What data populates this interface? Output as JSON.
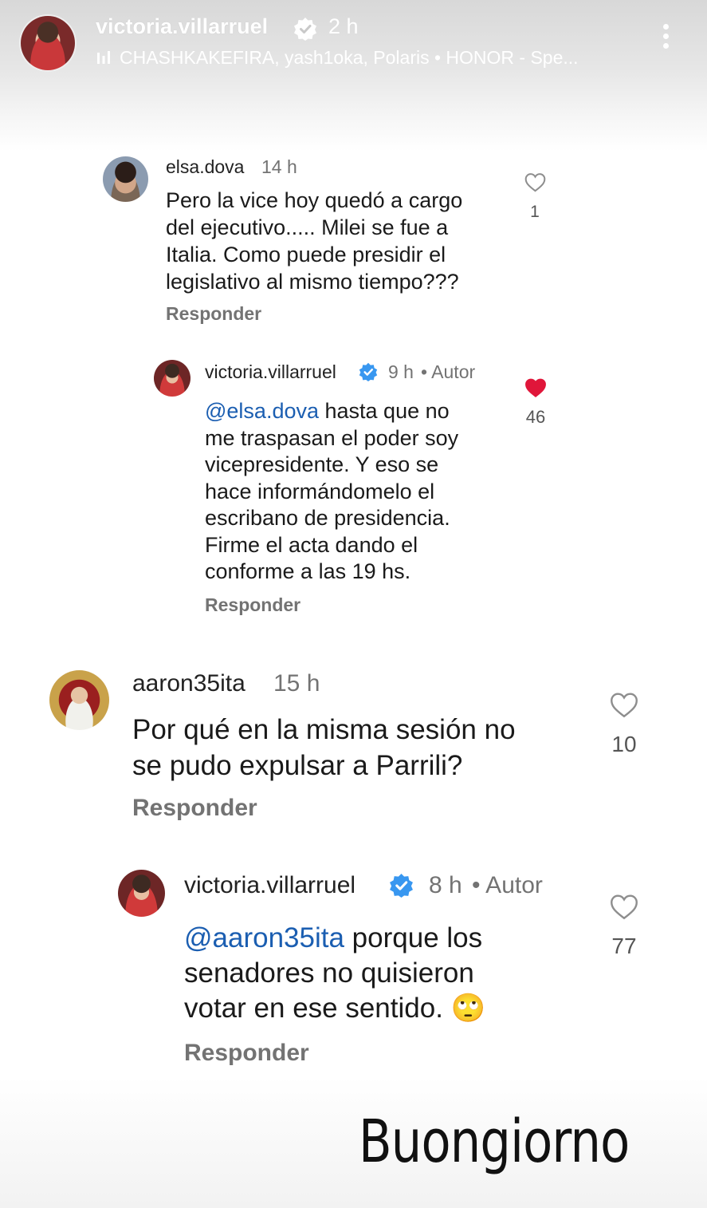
{
  "story": {
    "username": "victoria.villarruel",
    "time": "2 h",
    "music": "CHASHKAKEFIRA, yash1oka, Polaris • HONOR - Spe..."
  },
  "comments": [
    {
      "username": "elsa.dova",
      "time": "14 h",
      "text": "Pero la vice hoy  quedó a cargo\ndel ejecutivo..... Milei se fue a\nItalia. Como puede presidir el\nlegislativo al mismo tiempo???",
      "reply_label": "Responder",
      "likes": "1"
    },
    {
      "username": "victoria.villarruel",
      "time": "9 h",
      "author_tag": "• Autor",
      "mention": "@elsa.dova",
      "text": " hasta que no\nme traspasan el poder soy\nvicepresidente. Y eso se\nhace informándomelo el\nescribano de presidencia.\nFirme el acta dando el\nconforme a las 19 hs.",
      "reply_label": "Responder",
      "likes": "46",
      "liked_color": "#e0163a"
    },
    {
      "username": "aaron35ita",
      "time": "15 h",
      "text": "Por qué en la misma sesión no\nse pudo expulsar a Parrili?",
      "reply_label": "Responder",
      "likes": "10"
    },
    {
      "username": "victoria.villarruel",
      "time": "8 h",
      "author_tag": "• Autor",
      "mention": "@aaron35ita",
      "text": " porque los\nsenadores no quisieron\nvotar en ese sentido. 🙄",
      "reply_label": "Responder",
      "likes": "77"
    }
  ],
  "caption": "Buongiorno",
  "colors": {
    "mention": "#1b5eb1",
    "verified": "#3897f0",
    "liked": "#e0163a"
  },
  "icons": {
    "verified": "verified-badge-icon",
    "heart": "heart-icon",
    "more": "more-vertical-icon",
    "music": "music-bars-icon"
  }
}
